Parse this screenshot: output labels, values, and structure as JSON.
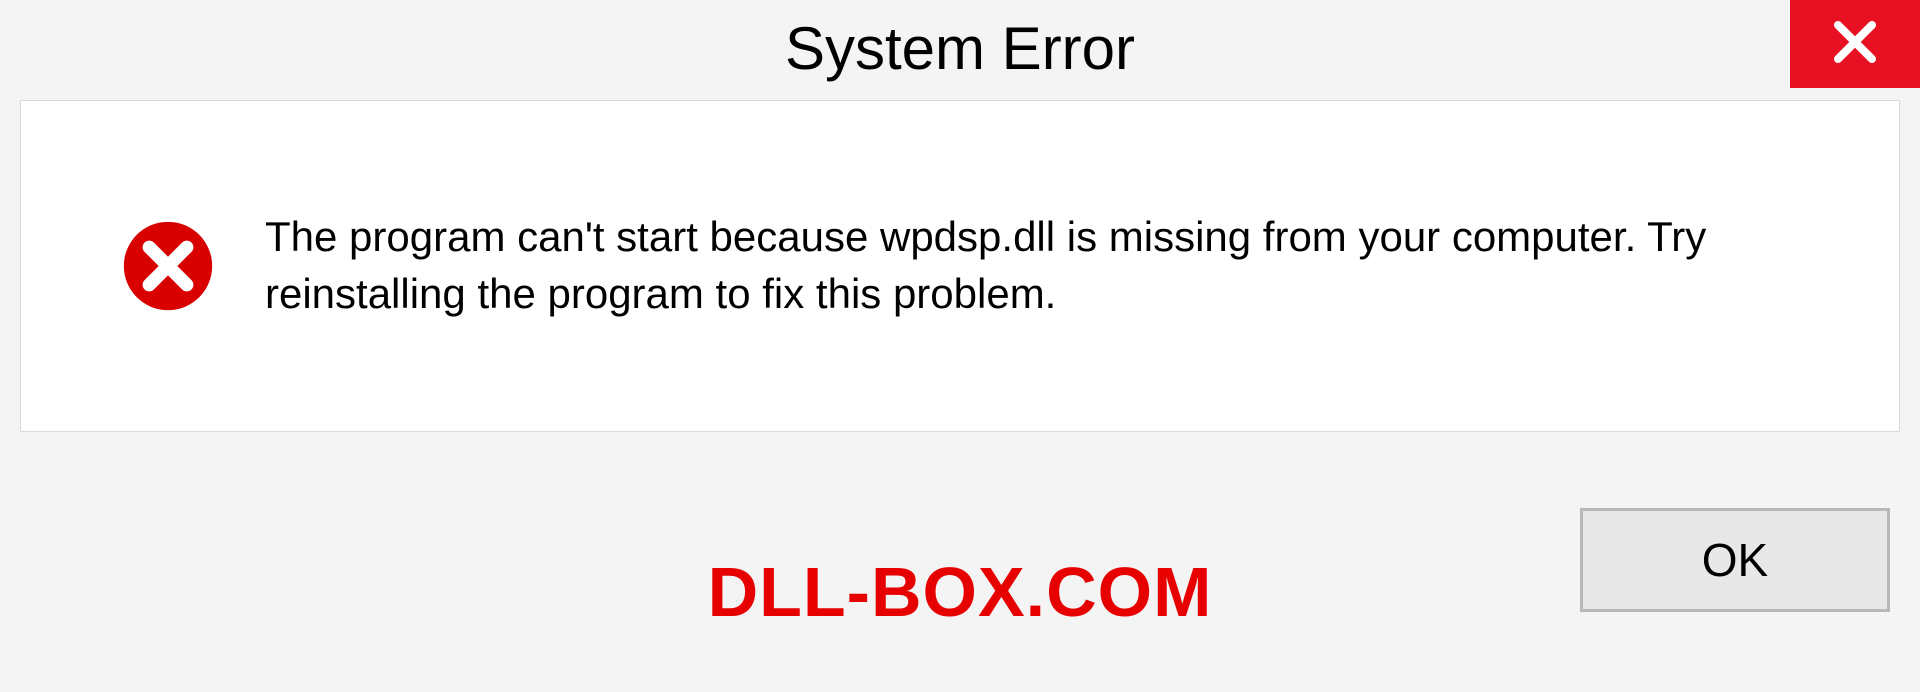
{
  "dialog": {
    "title": "System Error",
    "message": "The program can't start because wpdsp.dll is missing from your computer. Try reinstalling the program to fix this problem.",
    "ok_label": "OK"
  },
  "watermark": "DLL-BOX.COM",
  "colors": {
    "accent_red": "#e81123",
    "error_red": "#e60000"
  }
}
